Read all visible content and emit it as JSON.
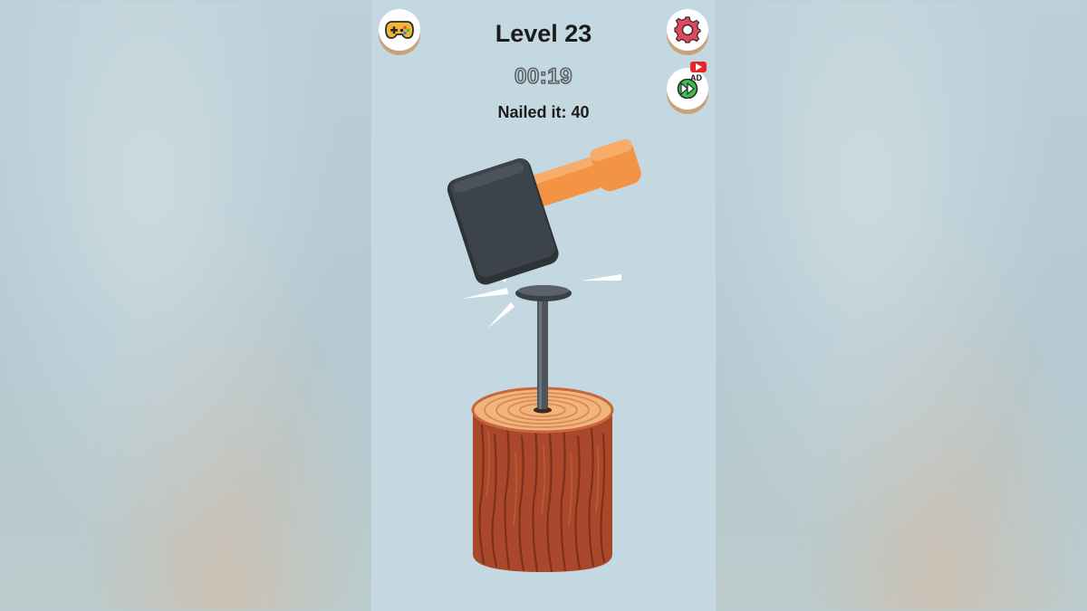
{
  "hud": {
    "level_label": "Level 23",
    "timer": "00:19",
    "score_label": "Nailed it: 40"
  },
  "buttons": {
    "games": {
      "icon": "gamepad-icon"
    },
    "settings": {
      "icon": "gear-icon"
    },
    "skip": {
      "icon": "fast-forward-icon",
      "badge_text": "AD"
    }
  },
  "colors": {
    "background": "#c3d8e1",
    "button_bg": "#ffffff",
    "button_shadow": "#c8a27b",
    "hammer_head": "#3d434b",
    "hammer_handle": "#f39444",
    "nail": "#4d545b",
    "log_bark": "#a9482b",
    "log_top": "#f0b47c",
    "ad_badge": "#e5262b",
    "gamepad": "#f2b632",
    "gear": "#e2475f",
    "skip_arrow": "#37c14a"
  }
}
